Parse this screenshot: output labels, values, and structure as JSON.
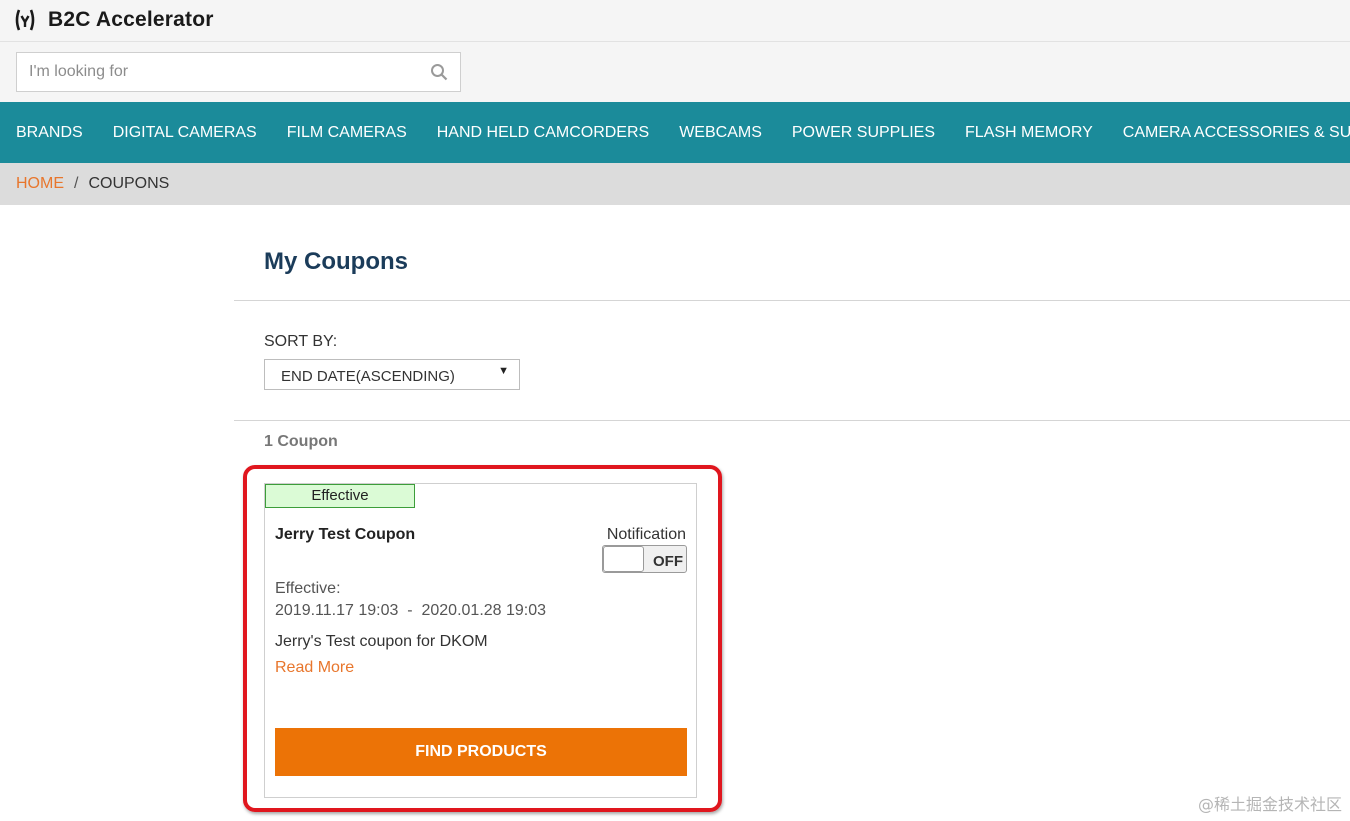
{
  "header": {
    "logo_text": "B2C Accelerator"
  },
  "search": {
    "placeholder": "I'm looking for",
    "value": ""
  },
  "nav": {
    "items": [
      {
        "label": "BRANDS"
      },
      {
        "label": "DIGITAL CAMERAS"
      },
      {
        "label": "FILM CAMERAS"
      },
      {
        "label": "HAND HELD CAMCORDERS"
      },
      {
        "label": "WEBCAMS"
      },
      {
        "label": "POWER SUPPLIES"
      },
      {
        "label": "FLASH MEMORY"
      },
      {
        "label": "CAMERA ACCESSORIES & SUPPLIES"
      }
    ]
  },
  "breadcrumb": {
    "home": "HOME",
    "separator": "/",
    "current": "COUPONS"
  },
  "main": {
    "title": "My Coupons",
    "sort_label": "SORT BY:",
    "sort_value": "END DATE(ASCENDING)",
    "count_text": "1 Coupon"
  },
  "coupon": {
    "status": "Effective",
    "name": "Jerry Test Coupon",
    "notification_label": "Notification",
    "toggle_state": "OFF",
    "effective_label": "Effective:",
    "effective_range": "2019.11.17 19:03  -  2020.01.28 19:03",
    "description": "Jerry's Test coupon for DKOM",
    "read_more": "Read More",
    "button_label": "FIND PRODUCTS"
  },
  "watermark": "@稀土掘金技术社区",
  "colors": {
    "nav_bg": "#1b8b9a",
    "accent_orange": "#ec7306",
    "title_blue": "#1b3c5a",
    "highlight_red": "#e0161e",
    "badge_green": "#dbfbd6"
  }
}
